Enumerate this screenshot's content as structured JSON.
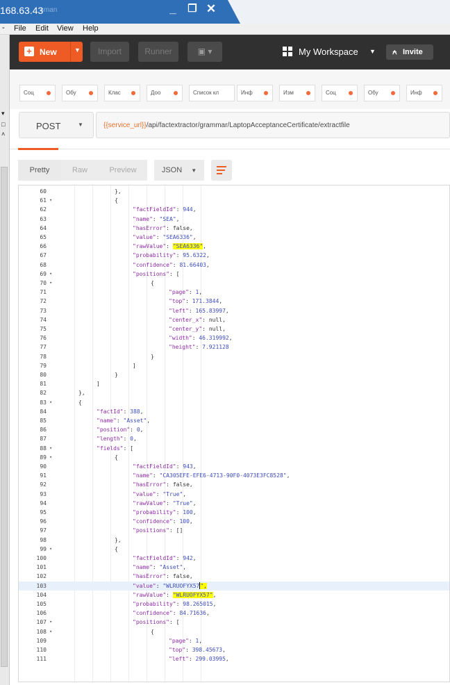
{
  "window": {
    "title_fragment": "168.63.43",
    "title_blur": "sman"
  },
  "menu": [
    "File",
    "Edit",
    "View",
    "Help"
  ],
  "header": {
    "new_label": "New",
    "import_label": "Import",
    "runner_label": "Runner",
    "workspace_label": "My Workspace",
    "invite_label": "Invite"
  },
  "tabs": [
    "Соц",
    "Обу",
    "Клас",
    "Доо",
    "Список кл",
    "Инф",
    "Изм",
    "Соц",
    "Обу",
    "Инф"
  ],
  "request": {
    "method": "POST",
    "url_var": "{{service_url}}",
    "url_path": "/api/factextractor/grammar/LaptopAcceptanceCertificate/extractfile"
  },
  "response_toolbar": {
    "pretty": "Pretty",
    "raw": "Raw",
    "preview": "Preview",
    "format": "JSON"
  },
  "colors": {
    "accent": "#ef5b25",
    "header_bg": "#303030",
    "key": "#8f2aa6",
    "string": "#3d4dbb",
    "highlight": "#ffff00"
  },
  "code_lines": [
    {
      "n": "60",
      "f": "",
      "d": 6,
      "t": "},"
    },
    {
      "n": "61",
      "f": "▾",
      "d": 6,
      "t": "{"
    },
    {
      "n": "62",
      "f": "",
      "d": 7,
      "k": "factFieldId",
      "v": "944",
      "vt": "n",
      "c": ","
    },
    {
      "n": "63",
      "f": "",
      "d": 7,
      "k": "name",
      "v": "\"SEA\"",
      "vt": "s",
      "c": ","
    },
    {
      "n": "64",
      "f": "",
      "d": 7,
      "k": "hasError",
      "v": "false",
      "vt": "p",
      "c": ","
    },
    {
      "n": "65",
      "f": "",
      "d": 7,
      "k": "value",
      "v": "\"SEA6336\"",
      "vt": "s",
      "c": ","
    },
    {
      "n": "66",
      "f": "",
      "d": 7,
      "k": "rawValue",
      "v": "\"SEA6336\"",
      "vt": "s",
      "c": ",",
      "hl": true
    },
    {
      "n": "67",
      "f": "",
      "d": 7,
      "k": "probability",
      "v": "95.6322",
      "vt": "n",
      "c": ","
    },
    {
      "n": "68",
      "f": "",
      "d": 7,
      "k": "confidence",
      "v": "81.66403",
      "vt": "n",
      "c": ","
    },
    {
      "n": "69",
      "f": "▾",
      "d": 7,
      "k": "positions",
      "v": "[",
      "vt": "p",
      "c": ""
    },
    {
      "n": "70",
      "f": "▾",
      "d": 8,
      "t": "{"
    },
    {
      "n": "71",
      "f": "",
      "d": 9,
      "k": "page",
      "v": "1",
      "vt": "n",
      "c": ","
    },
    {
      "n": "72",
      "f": "",
      "d": 9,
      "k": "top",
      "v": "171.3844",
      "vt": "n",
      "c": ","
    },
    {
      "n": "73",
      "f": "",
      "d": 9,
      "k": "left",
      "v": "165.83997",
      "vt": "n",
      "c": ","
    },
    {
      "n": "74",
      "f": "",
      "d": 9,
      "k": "center_x",
      "v": "null",
      "vt": "p",
      "c": ","
    },
    {
      "n": "75",
      "f": "",
      "d": 9,
      "k": "center_y",
      "v": "null",
      "vt": "p",
      "c": ","
    },
    {
      "n": "76",
      "f": "",
      "d": 9,
      "k": "width",
      "v": "46.319992",
      "vt": "n",
      "c": ","
    },
    {
      "n": "77",
      "f": "",
      "d": 9,
      "k": "height",
      "v": "7.921128",
      "vt": "n",
      "c": ""
    },
    {
      "n": "78",
      "f": "",
      "d": 8,
      "t": "}"
    },
    {
      "n": "79",
      "f": "",
      "d": 7,
      "t": "]"
    },
    {
      "n": "80",
      "f": "",
      "d": 6,
      "t": "}"
    },
    {
      "n": "81",
      "f": "",
      "d": 5,
      "t": "]"
    },
    {
      "n": "82",
      "f": "",
      "d": 4,
      "t": "},"
    },
    {
      "n": "83",
      "f": "▾",
      "d": 4,
      "t": "{"
    },
    {
      "n": "84",
      "f": "",
      "d": 5,
      "k": "factId",
      "v": "388",
      "vt": "n",
      "c": ","
    },
    {
      "n": "85",
      "f": "",
      "d": 5,
      "k": "name",
      "v": "\"Asset\"",
      "vt": "s",
      "c": ","
    },
    {
      "n": "86",
      "f": "",
      "d": 5,
      "k": "position",
      "v": "0",
      "vt": "n",
      "c": ","
    },
    {
      "n": "87",
      "f": "",
      "d": 5,
      "k": "length",
      "v": "0",
      "vt": "n",
      "c": ","
    },
    {
      "n": "88",
      "f": "▾",
      "d": 5,
      "k": "fields",
      "v": "[",
      "vt": "p",
      "c": ""
    },
    {
      "n": "89",
      "f": "▾",
      "d": 6,
      "t": "{"
    },
    {
      "n": "90",
      "f": "",
      "d": 7,
      "k": "factFieldId",
      "v": "943",
      "vt": "n",
      "c": ","
    },
    {
      "n": "91",
      "f": "",
      "d": 7,
      "k": "name",
      "v": "\"CA305EFE-EFE6-4713-90F0-4073E3FC8528\"",
      "vt": "s",
      "c": ","
    },
    {
      "n": "92",
      "f": "",
      "d": 7,
      "k": "hasError",
      "v": "false",
      "vt": "p",
      "c": ","
    },
    {
      "n": "93",
      "f": "",
      "d": 7,
      "k": "value",
      "v": "\"True\"",
      "vt": "s",
      "c": ","
    },
    {
      "n": "94",
      "f": "",
      "d": 7,
      "k": "rawValue",
      "v": "\"True\"",
      "vt": "s",
      "c": ","
    },
    {
      "n": "95",
      "f": "",
      "d": 7,
      "k": "probability",
      "v": "100",
      "vt": "n",
      "c": ","
    },
    {
      "n": "96",
      "f": "",
      "d": 7,
      "k": "confidence",
      "v": "100",
      "vt": "n",
      "c": ","
    },
    {
      "n": "97",
      "f": "",
      "d": 7,
      "k": "positions",
      "v": "[]",
      "vt": "p",
      "c": ""
    },
    {
      "n": "98",
      "f": "",
      "d": 6,
      "t": "},"
    },
    {
      "n": "99",
      "f": "▾",
      "d": 6,
      "t": "{"
    },
    {
      "n": "100",
      "f": "",
      "d": 7,
      "k": "factFieldId",
      "v": "942",
      "vt": "n",
      "c": ","
    },
    {
      "n": "101",
      "f": "",
      "d": 7,
      "k": "name",
      "v": "\"Asset\"",
      "vt": "s",
      "c": ","
    },
    {
      "n": "102",
      "f": "",
      "d": 7,
      "k": "hasError",
      "v": "false",
      "vt": "p",
      "c": ","
    },
    {
      "n": "103",
      "f": "",
      "d": 7,
      "k": "value",
      "v": "\"WLRUOFYX57\"",
      "vt": "s",
      "c": ",",
      "cur": true,
      "hlc": true
    },
    {
      "n": "104",
      "f": "",
      "d": 7,
      "k": "rawValue",
      "v": "\"WLRUOFYX57\"",
      "vt": "s",
      "c": ",",
      "hl": true
    },
    {
      "n": "105",
      "f": "",
      "d": 7,
      "k": "probability",
      "v": "98.265015",
      "vt": "n",
      "c": ","
    },
    {
      "n": "106",
      "f": "",
      "d": 7,
      "k": "confidence",
      "v": "84.71636",
      "vt": "n",
      "c": ","
    },
    {
      "n": "107",
      "f": "▾",
      "d": 7,
      "k": "positions",
      "v": "[",
      "vt": "p",
      "c": ""
    },
    {
      "n": "108",
      "f": "▾",
      "d": 8,
      "t": "{"
    },
    {
      "n": "109",
      "f": "",
      "d": 9,
      "k": "page",
      "v": "1",
      "vt": "n",
      "c": ","
    },
    {
      "n": "110",
      "f": "",
      "d": 9,
      "k": "top",
      "v": "398.45673",
      "vt": "n",
      "c": ","
    },
    {
      "n": "111",
      "f": "",
      "d": 9,
      "k": "left",
      "v": "299.03995",
      "vt": "n",
      "c": ","
    }
  ]
}
